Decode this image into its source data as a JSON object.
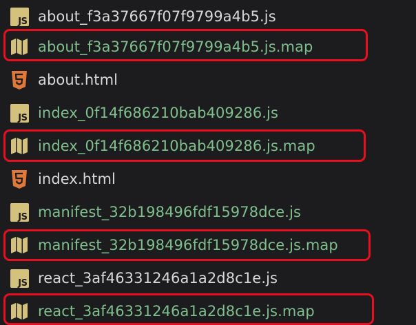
{
  "files": [
    {
      "name": "about_f3a37667f07f9799a4b5.js",
      "icon": "js-file-icon",
      "kind": "js",
      "color": "#d8d8d8"
    },
    {
      "name": "about_f3a37667f07f9799a4b5.js.map",
      "icon": "map-file-icon",
      "kind": "map",
      "color": "#7fbf8e",
      "highlighted": true
    },
    {
      "name": "about.html",
      "icon": "html5-file-icon",
      "kind": "html",
      "color": "#d8d8d8"
    },
    {
      "name": "index_0f14f686210bab409286.js",
      "icon": "js-file-icon",
      "kind": "js",
      "color": "#7fbf8e"
    },
    {
      "name": "index_0f14f686210bab409286.js.map",
      "icon": "map-file-icon",
      "kind": "map",
      "color": "#7fbf8e",
      "highlighted": true
    },
    {
      "name": "index.html",
      "icon": "html5-file-icon",
      "kind": "html",
      "color": "#d8d8d8"
    },
    {
      "name": "manifest_32b198496fdf15978dce.js",
      "icon": "js-file-icon",
      "kind": "js",
      "color": "#7fbf8e"
    },
    {
      "name": "manifest_32b198496fdf15978dce.js.map",
      "icon": "map-file-icon",
      "kind": "map",
      "color": "#7fbf8e",
      "highlighted": true
    },
    {
      "name": "react_3af46331246a1a2d8c1e.js",
      "icon": "js-file-icon",
      "kind": "js",
      "color": "#d8d8d8"
    },
    {
      "name": "react_3af46331246a1a2d8c1e.js.map",
      "icon": "map-file-icon",
      "kind": "map",
      "color": "#7fbf8e",
      "highlighted": true
    }
  ],
  "js_icon_text": "JS",
  "colors": {
    "background": "#1c1c1e",
    "highlight_border": "#e8101e",
    "js_icon": "#d4c27c",
    "html_icon": "#e0783a",
    "map_icon": "#d4c27c"
  }
}
